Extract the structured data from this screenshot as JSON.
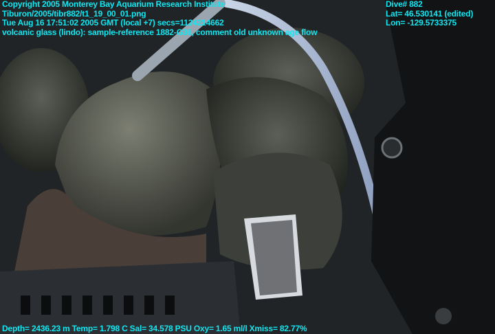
{
  "overlay": {
    "top_left": [
      "Copyright 2005 Monterey Bay Aquarium Research Institute",
      "Tiburon/2005/tibr882/t1_19_00_01.png",
      "Tue Aug 16 17:51:02 2005 GMT (local +7)  secs=1124214662",
      "volcanic glass (lindo): sample-reference 1882-G36, comment old unknown age flow"
    ],
    "top_right": [
      "Dive# 882",
      "Lat= 46.530141 (edited)",
      "Lon= -129.5733375"
    ],
    "bottom": "Depth= 2436.23 m  Temp= 1.798 C  Sal= 34.578 PSU  Oxy= 1.65 ml/l  Xmiss= 82.77%"
  },
  "colors": {
    "overlay_text": "#12e6f0"
  }
}
